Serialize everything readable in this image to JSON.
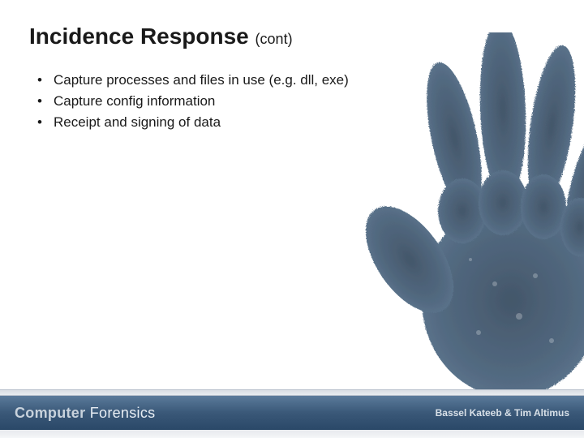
{
  "title_main": "Incidence Response",
  "title_suffix": "(cont)",
  "bullets": [
    "Capture processes and files in use (e.g. dll, exe)",
    "Capture config information",
    "Receipt and signing of data"
  ],
  "footer": {
    "brand_left_strong": "Computer",
    "brand_left_light": "Forensics",
    "authors": "Bassel Kateeb & Tim Altimus"
  }
}
